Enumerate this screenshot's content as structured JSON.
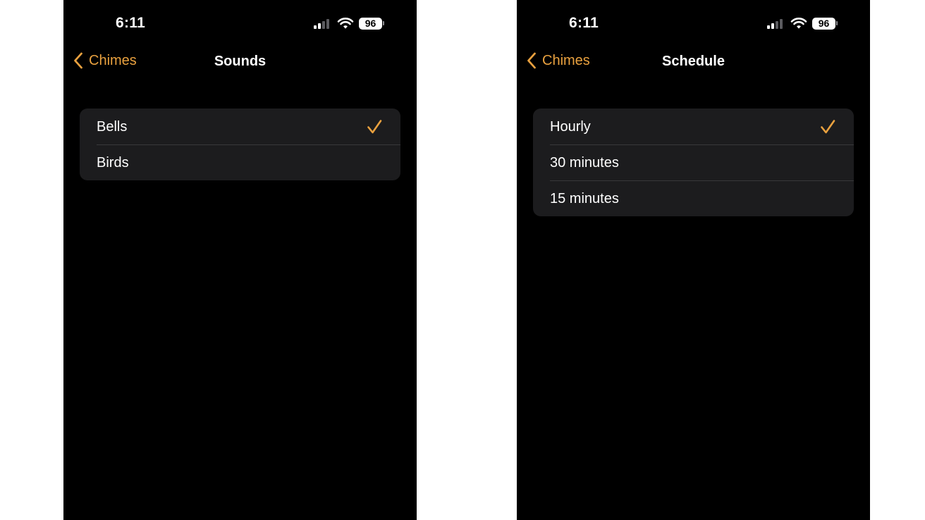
{
  "colors": {
    "accent": "#e9a13f",
    "screen_background": "#000000",
    "group_background": "#1c1c1e",
    "separator": "#38383a",
    "page_background": "#ffffff"
  },
  "screens": [
    {
      "status_bar": {
        "time": "6:11",
        "battery": "96",
        "icons": [
          "cellular-signal-icon",
          "wifi-icon",
          "battery-icon"
        ]
      },
      "nav": {
        "back_label": "Chimes",
        "back_icon": "chevron-left-icon",
        "title": "Sounds"
      },
      "options": [
        {
          "label": "Bells",
          "selected": true
        },
        {
          "label": "Birds",
          "selected": false
        }
      ]
    },
    {
      "status_bar": {
        "time": "6:11",
        "battery": "96",
        "icons": [
          "cellular-signal-icon",
          "wifi-icon",
          "battery-icon"
        ]
      },
      "nav": {
        "back_label": "Chimes",
        "back_icon": "chevron-left-icon",
        "title": "Schedule"
      },
      "options": [
        {
          "label": "Hourly",
          "selected": true
        },
        {
          "label": "30 minutes",
          "selected": false
        },
        {
          "label": "15 minutes",
          "selected": false
        }
      ]
    }
  ]
}
